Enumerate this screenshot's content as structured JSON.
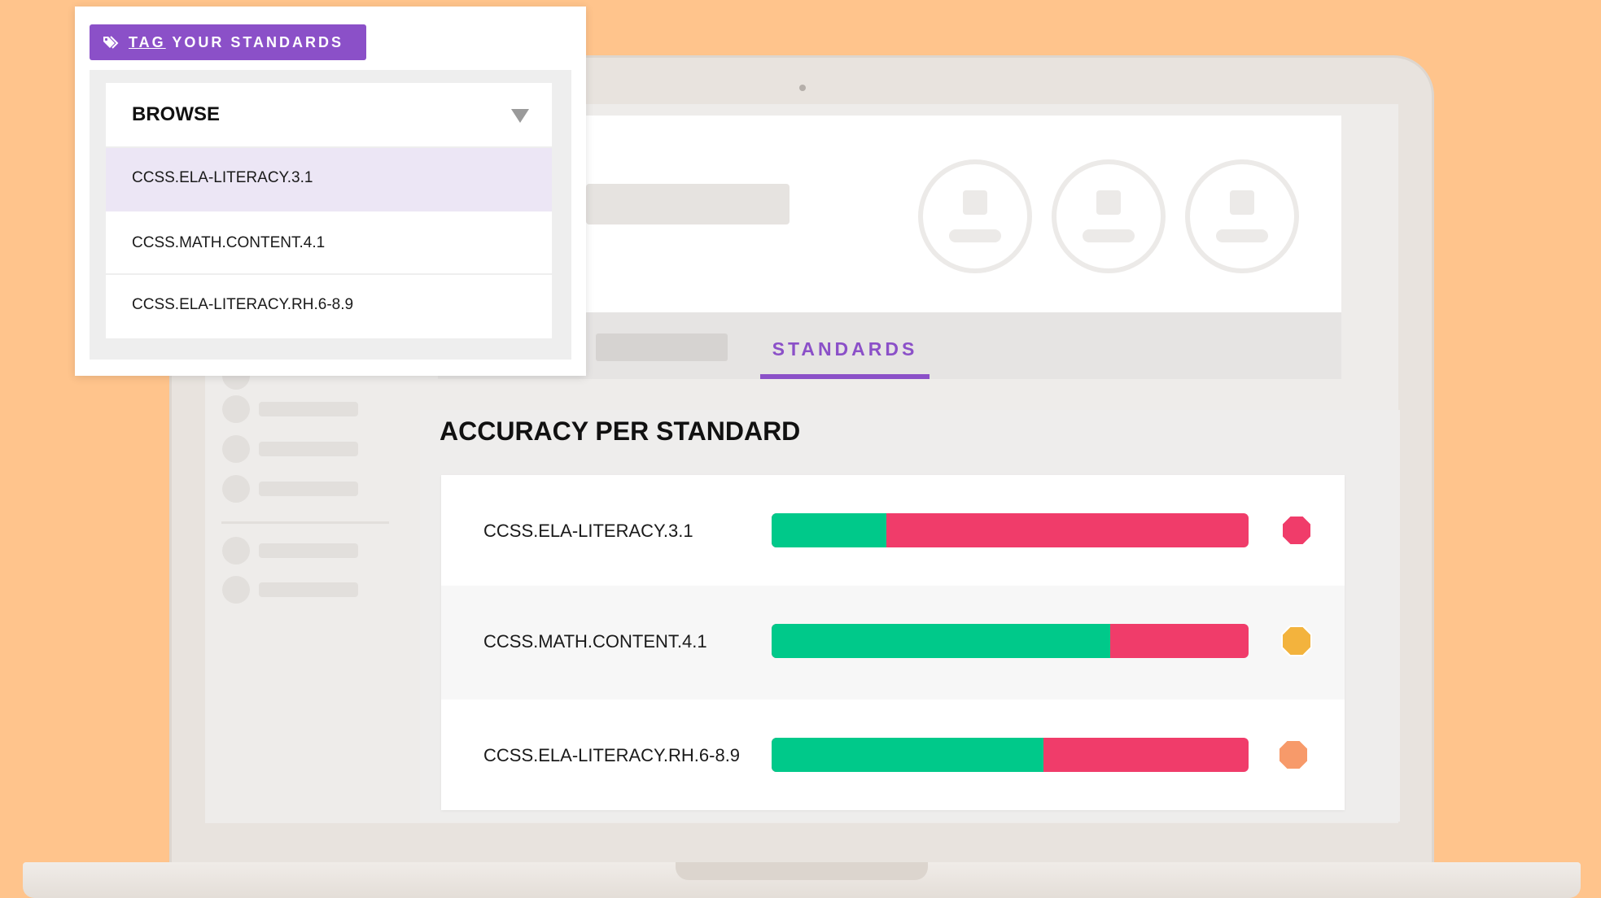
{
  "tag_popover": {
    "button_label_underlined": "TAG",
    "button_label_rest": " YOUR STANDARDS",
    "dropdown_label": "BROWSE",
    "options": [
      {
        "label": "CCSS.ELA-LITERACY.3.1",
        "selected": true
      },
      {
        "label": "CCSS.MATH.CONTENT.4.1",
        "selected": false
      },
      {
        "label": "CCSS.ELA-LITERACY.RH.6-8.9",
        "selected": false
      }
    ]
  },
  "tabs": {
    "active_label": "STANDARDS"
  },
  "accuracy": {
    "title": "ACCURACY PER STANDARD",
    "rows": [
      {
        "standard": "CCSS.ELA-LITERACY.3.1",
        "correct_fraction": 0.24,
        "status_color": "#F03C6A"
      },
      {
        "standard": "CCSS.MATH.CONTENT.4.1",
        "correct_fraction": 0.71,
        "status_color": "#F3B33D"
      },
      {
        "standard": "CCSS.ELA-LITERACY.RH.6-8.9",
        "correct_fraction": 0.57,
        "status_color": "#F79A6A"
      }
    ]
  },
  "colors": {
    "background": "#FFC48C",
    "accent_purple": "#8B50C8",
    "bar_correct": "#00C98A",
    "bar_incorrect": "#F03C6A"
  },
  "icons": {
    "tag": "tag-icon",
    "dropdown": "caret-down-icon",
    "status": "octagon-icon",
    "avatar": "avatar-placeholder-icon"
  }
}
